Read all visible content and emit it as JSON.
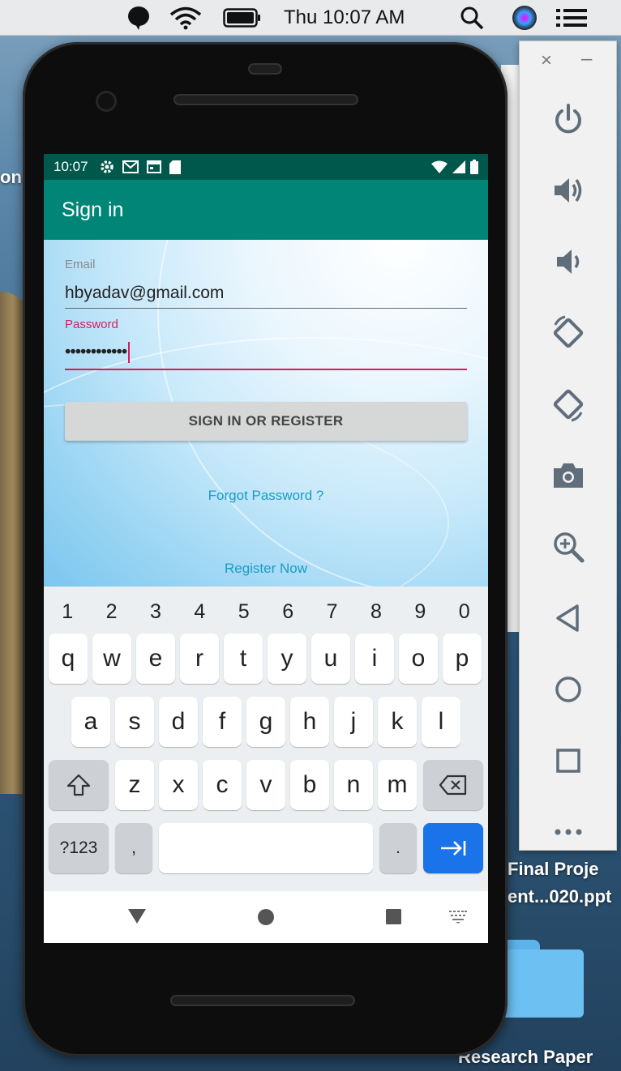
{
  "menubar": {
    "clock": "Thu 10:07 AM",
    "icons": [
      "chat-bubble-icon",
      "wifi-icon",
      "battery-icon",
      "search-icon",
      "siri-icon",
      "control-center-icon"
    ]
  },
  "desktop": {
    "left_label_fragment": "on",
    "file_label_line1": "Final Proje",
    "file_label_line2": "ent...020.ppt",
    "folder_label": "Research Paper"
  },
  "phone": {
    "status": {
      "time": "10:07",
      "icons": [
        "settings-icon",
        "gmail-icon",
        "calendar-icon",
        "sd-card-icon",
        "wifi-icon",
        "signal-icon",
        "battery-icon"
      ]
    },
    "app_bar": {
      "title": "Sign in"
    },
    "form": {
      "email_label": "Email",
      "email_value": "hbyadav@gmail.com",
      "password_label": "Password",
      "password_value": "••••••••••••",
      "sign_in_button": "SIGN IN OR REGISTER",
      "forgot_link": "Forgot Password ?",
      "register_link": "Register Now"
    },
    "colors": {
      "accent": "#d81b60",
      "primary": "#008577",
      "primary_dark": "#00574b",
      "link": "#1a9bc7"
    },
    "keyboard": {
      "numbers": [
        "1",
        "2",
        "3",
        "4",
        "5",
        "6",
        "7",
        "8",
        "9",
        "0"
      ],
      "row1": [
        "q",
        "w",
        "e",
        "r",
        "t",
        "y",
        "u",
        "i",
        "o",
        "p"
      ],
      "row2": [
        "a",
        "s",
        "d",
        "f",
        "g",
        "h",
        "j",
        "k",
        "l"
      ],
      "row3": [
        "z",
        "x",
        "c",
        "v",
        "b",
        "n",
        "m"
      ],
      "symbols_key": "?123",
      "comma_key": ",",
      "period_key": ".",
      "icons": [
        "shift-icon",
        "backspace-icon",
        "next-arrow-icon"
      ]
    },
    "navbar": {
      "icons": [
        "back-triangle-icon",
        "home-circle-icon",
        "recents-square-icon",
        "keyboard-switch-icon"
      ]
    }
  },
  "emulator_panel": {
    "buttons": [
      "power-icon",
      "volume-up-icon",
      "volume-down-icon",
      "rotate-left-icon",
      "rotate-right-icon",
      "camera-icon",
      "zoom-icon",
      "back-icon",
      "home-icon",
      "overview-icon",
      "more-icon"
    ]
  }
}
